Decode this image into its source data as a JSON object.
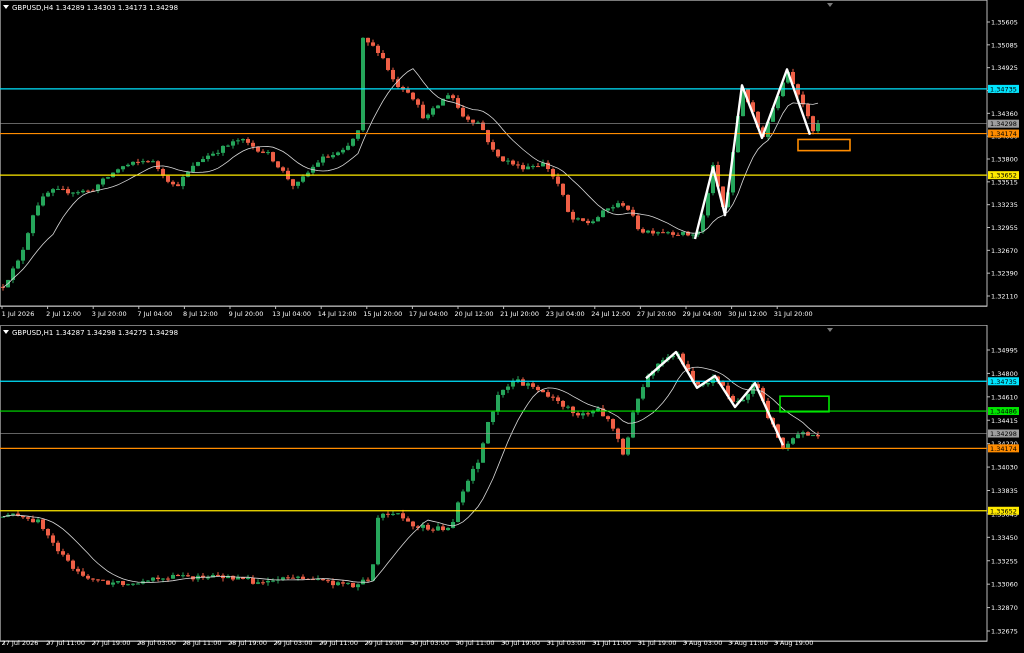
{
  "chart_data": [
    {
      "type": "candlestick",
      "title": "GBPUSD,H4  1.34289 1.34303 1.34173 1.34298",
      "ylim": [
        1.3211,
        1.357
      ],
      "yticks": [
        "1.35605",
        "1.35085",
        "1.34925",
        "1.34640",
        "1.34360",
        "1.34080",
        "1.33800",
        "1.33515",
        "1.33235",
        "1.32955",
        "1.32670",
        "1.32390",
        "1.32110"
      ],
      "xticks": [
        "1 Jul 2026",
        "2 Jul 12:00",
        "3 Jul 20:00",
        "7 Jul 04:00",
        "8 Jul 12:00",
        "9 Jul 20:00",
        "13 Jul 04:00",
        "14 Jul 12:00",
        "15 Jul 20:00",
        "17 Jul 04:00",
        "20 Jul 12:00",
        "21 Jul 20:00",
        "23 Jul 04:00",
        "24 Jul 12:00",
        "27 Jul 20:00",
        "29 Jul 04:00",
        "30 Jul 12:00",
        "31 Jul 20:00"
      ],
      "levels": [
        {
          "price": 1.34735,
          "label": "1.34735",
          "color": "#00e5ff"
        },
        {
          "price": 1.34298,
          "label": "1.34298",
          "color": "#9e9e9e"
        },
        {
          "price": 1.34174,
          "label": "1.34174",
          "color": "#ff8c00"
        },
        {
          "price": 1.33652,
          "label": "1.33652",
          "color": "#ffea00"
        }
      ],
      "path": [
        {
          "x": 695,
          "price": 1.3285
        },
        {
          "x": 713,
          "price": 1.3375
        },
        {
          "x": 725,
          "price": 1.3315
        },
        {
          "x": 742,
          "price": 1.3478
        },
        {
          "x": 762,
          "price": 1.3412
        },
        {
          "x": 787,
          "price": 1.3498
        },
        {
          "x": 810,
          "price": 1.3416
        }
      ],
      "path_color": "#ffffff",
      "box": {
        "x0": 798,
        "x1": 850,
        "price_top": 1.341,
        "price_bottom": 1.3396,
        "color": "#ff8c00"
      }
    },
    {
      "type": "candlestick",
      "title": "GBPUSD,H1  1.34287 1.34298 1.34275 1.34298",
      "ylim": [
        1.3263,
        1.3508
      ],
      "yticks": [
        "1.34995",
        "1.34800",
        "1.34610",
        "1.34415",
        "1.34220",
        "1.34030",
        "1.33835",
        "1.33645",
        "1.33450",
        "1.33255",
        "1.33060",
        "1.32870",
        "1.32675"
      ],
      "xticks": [
        "27 Jul 2026",
        "27 Jul 11:00",
        "27 Jul 19:00",
        "28 Jul 03:00",
        "28 Jul 11:00",
        "28 Jul 19:00",
        "29 Jul 03:00",
        "29 Jul 11:00",
        "29 Jul 19:00",
        "30 Jul 03:00",
        "30 Jul 11:00",
        "30 Jul 19:00",
        "31 Jul 03:00",
        "31 Jul 11:00",
        "31 Jul 19:00",
        "3 Aug 03:00",
        "3 Aug 11:00",
        "3 Aug 19:00"
      ],
      "levels": [
        {
          "price": 1.34735,
          "label": "1.34735",
          "color": "#00e5ff"
        },
        {
          "price": 1.34486,
          "label": "1.34486",
          "color": "#00e600"
        },
        {
          "price": 1.34298,
          "label": "1.34298",
          "color": "#9e9e9e"
        },
        {
          "price": 1.34174,
          "label": "1.34174",
          "color": "#ff8c00"
        },
        {
          "price": 1.33652,
          "label": "1.33652",
          "color": "#ffea00"
        }
      ],
      "path": [
        {
          "x": 646,
          "price": 1.3476
        },
        {
          "x": 676,
          "price": 1.3498
        },
        {
          "x": 697,
          "price": 1.3468
        },
        {
          "x": 715,
          "price": 1.3478
        },
        {
          "x": 735,
          "price": 1.3452
        },
        {
          "x": 755,
          "price": 1.3472
        },
        {
          "x": 783,
          "price": 1.342
        }
      ],
      "path_color": "#ffffff",
      "box": {
        "x0": 780,
        "x1": 829,
        "price_top": 1.3461,
        "price_bottom": 1.3448,
        "color": "#00e600"
      }
    }
  ]
}
